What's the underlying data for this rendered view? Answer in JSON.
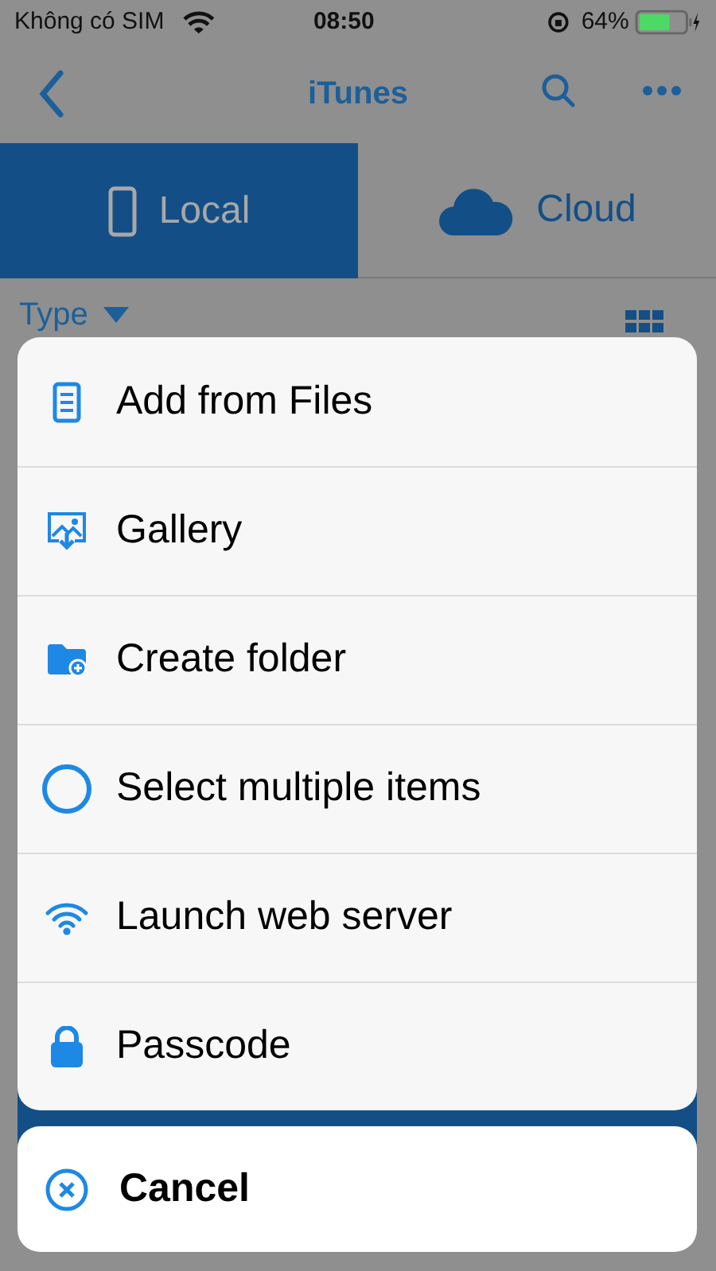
{
  "status_bar": {
    "carrier": "Không có SIM",
    "time": "08:50",
    "battery": "64%"
  },
  "nav": {
    "title": "iTunes"
  },
  "tabs": [
    {
      "label": "Local",
      "selected": true,
      "kind": "phone"
    },
    {
      "label": "Cloud",
      "selected": false,
      "kind": "cloud"
    }
  ],
  "filter": {
    "label": "Type"
  },
  "action_sheet": {
    "items": [
      {
        "label": "Add from Files",
        "kind": "file"
      },
      {
        "label": "Gallery",
        "kind": "gallery"
      },
      {
        "label": "Create folder",
        "kind": "folder"
      },
      {
        "label": "Select multiple items",
        "kind": "select"
      },
      {
        "label": "Launch web server",
        "kind": "wifi"
      },
      {
        "label": "Passcode",
        "kind": "lock"
      }
    ],
    "cancel": "Cancel"
  }
}
